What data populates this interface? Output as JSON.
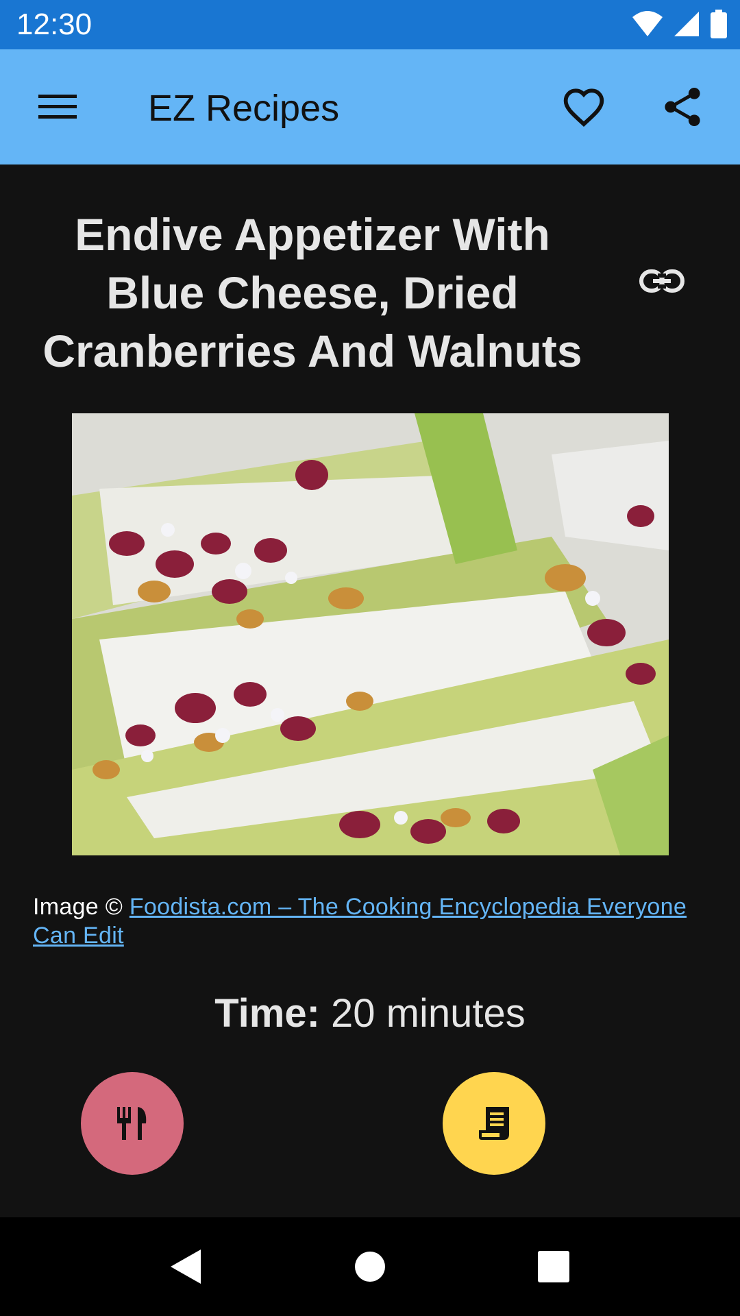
{
  "status_bar": {
    "time": "12:30",
    "icons": [
      "wifi-icon",
      "signal-icon",
      "battery-icon"
    ]
  },
  "app_bar": {
    "title": "EZ Recipes",
    "menu_icon": "menu-icon",
    "favorite_icon": "heart-outline-icon",
    "share_icon": "share-icon",
    "background_color": "#64b5f6"
  },
  "recipe": {
    "title": "Endive Appetizer With Blue Cheese, Dried Cranberries And Walnuts",
    "link_icon": "link-icon",
    "image_credit_prefix": "Image © ",
    "image_credit_link": "Foodista.com – The Cooking Encyclopedia Everyone Can Edit",
    "time_label": "Time:",
    "time_value": "20 minutes"
  },
  "actions": {
    "ingredients_icon": "utensils-icon",
    "ingredients_color": "#d4697c",
    "steps_icon": "receipt-icon",
    "steps_color": "#ffd54f"
  },
  "nav_bar": {
    "icons": [
      "back-icon",
      "home-icon",
      "recents-icon"
    ]
  }
}
